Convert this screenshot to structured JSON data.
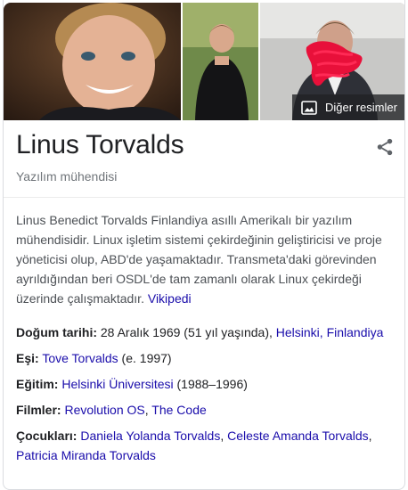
{
  "images": {
    "more_images_label": "Diğer resimler"
  },
  "header": {
    "title": "Linus Torvalds",
    "subtitle": "Yazılım mühendisi"
  },
  "description": {
    "text": "Linus Benedict Torvalds Finlandiya asıllı Amerikalı bir yazılım mühendisidir. Linux işletim sistemi çekirdeğinin geliştiricisi ve proje yöneticisi olup, ABD'de yaşamaktadır. Transmeta'daki görevinden ayrıldığından beri OSDL'de tam zamanlı olarak Linux çekirdeği üzerinde çalışmaktadır. ",
    "source_link": "Vikipedi"
  },
  "facts": {
    "birth": {
      "label": "Doğum tarihi:",
      "date": " 28 Aralık 1969 (51 yıl yaşında), ",
      "place_link": "Helsinki, Finlandiya"
    },
    "spouse": {
      "label": "Eşi:",
      "link": "Tove Torvalds",
      "extra": " (e. 1997)"
    },
    "education": {
      "label": "Eğitim:",
      "link": "Helsinki Üniversitesi",
      "extra": " (1988–1996)"
    },
    "films": {
      "label": "Filmler:",
      "link1": "Revolution OS",
      "sep": ", ",
      "link2": "The Code"
    },
    "children": {
      "label": "Çocukları:",
      "link1": "Daniela Yolanda Torvalds",
      "sep1": ", ",
      "link2": "Celeste Amanda Torvalds",
      "sep2": ", ",
      "link3": "Patricia Miranda Torvalds"
    }
  },
  "colors": {
    "link": "#1a0dab",
    "text": "#202124",
    "muted": "#70757a",
    "scribble": "#e8103a"
  }
}
